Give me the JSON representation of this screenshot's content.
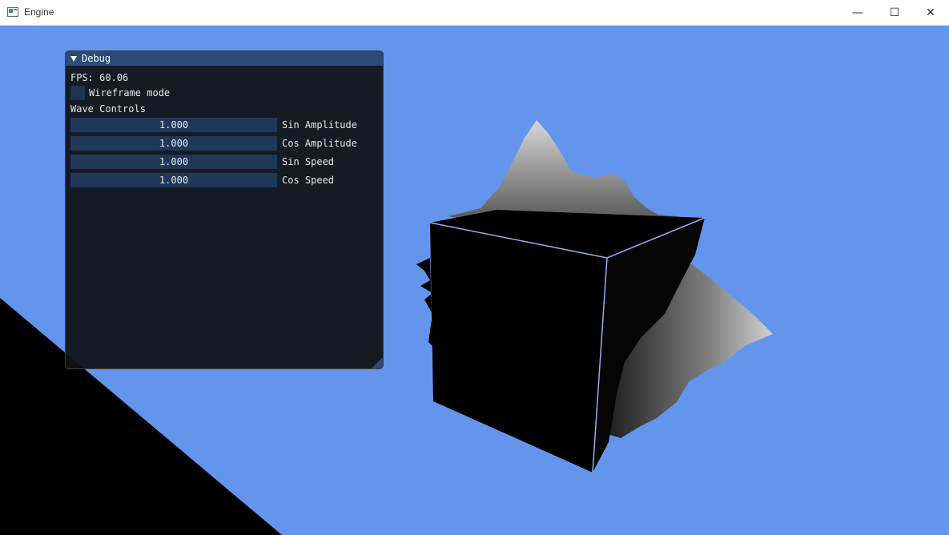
{
  "window": {
    "title": "Engine",
    "minimize_glyph": "—",
    "maximize_glyph": "☐",
    "close_glyph": "✕"
  },
  "debug": {
    "title": "Debug",
    "fps_label": "FPS: 60.06",
    "wireframe": {
      "label": "Wireframe mode",
      "checked": false
    },
    "wave_heading": "Wave Controls",
    "sliders": [
      {
        "value": "1.000",
        "label": "Sin Amplitude"
      },
      {
        "value": "1.000",
        "label": "Cos Amplitude"
      },
      {
        "value": "1.000",
        "label": "Sin Speed"
      },
      {
        "value": "1.000",
        "label": "Cos Speed"
      }
    ]
  },
  "colors": {
    "background": "#6495ed",
    "panel_header": "#294a7a",
    "slider_bg": "#203858",
    "cube_edge": "#8fb0f0"
  },
  "icons": {
    "app": "app-window-icon",
    "collapse": "triangle-down-icon"
  }
}
